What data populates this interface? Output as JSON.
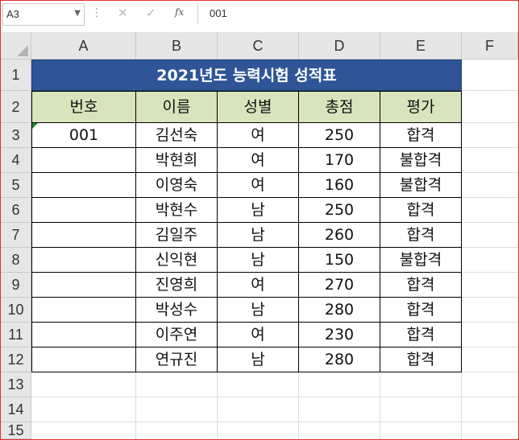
{
  "formula_bar": {
    "name_box": "A3",
    "cancel_icon": "✕",
    "enter_icon": "✓",
    "fx_label": "fx",
    "content": "001"
  },
  "columns": [
    "A",
    "B",
    "C",
    "D",
    "E",
    "F"
  ],
  "rows": [
    "1",
    "2",
    "3",
    "4",
    "5",
    "6",
    "7",
    "8",
    "9",
    "10",
    "11",
    "12",
    "13",
    "14",
    "15"
  ],
  "sheet": {
    "title": "2021년도 능력시험 성적표",
    "headers": [
      "번호",
      "이름",
      "성별",
      "총점",
      "평가"
    ],
    "records": [
      [
        "001",
        "김선숙",
        "여",
        "250",
        "합격"
      ],
      [
        "",
        "박현희",
        "여",
        "170",
        "불합격"
      ],
      [
        "",
        "이영숙",
        "여",
        "160",
        "불합격"
      ],
      [
        "",
        "박현수",
        "남",
        "250",
        "합격"
      ],
      [
        "",
        "김일주",
        "남",
        "260",
        "합격"
      ],
      [
        "",
        "신익현",
        "남",
        "150",
        "불합격"
      ],
      [
        "",
        "진영희",
        "여",
        "270",
        "합격"
      ],
      [
        "",
        "박성수",
        "남",
        "280",
        "합격"
      ],
      [
        "",
        "이주연",
        "여",
        "230",
        "합격"
      ],
      [
        "",
        "연규진",
        "남",
        "280",
        "합격"
      ]
    ]
  },
  "colors": {
    "title_fill": "#2F5597",
    "header_fill": "#D8E4BC",
    "grid_border": "#000000",
    "error_indicator": "#1E8A3A"
  }
}
